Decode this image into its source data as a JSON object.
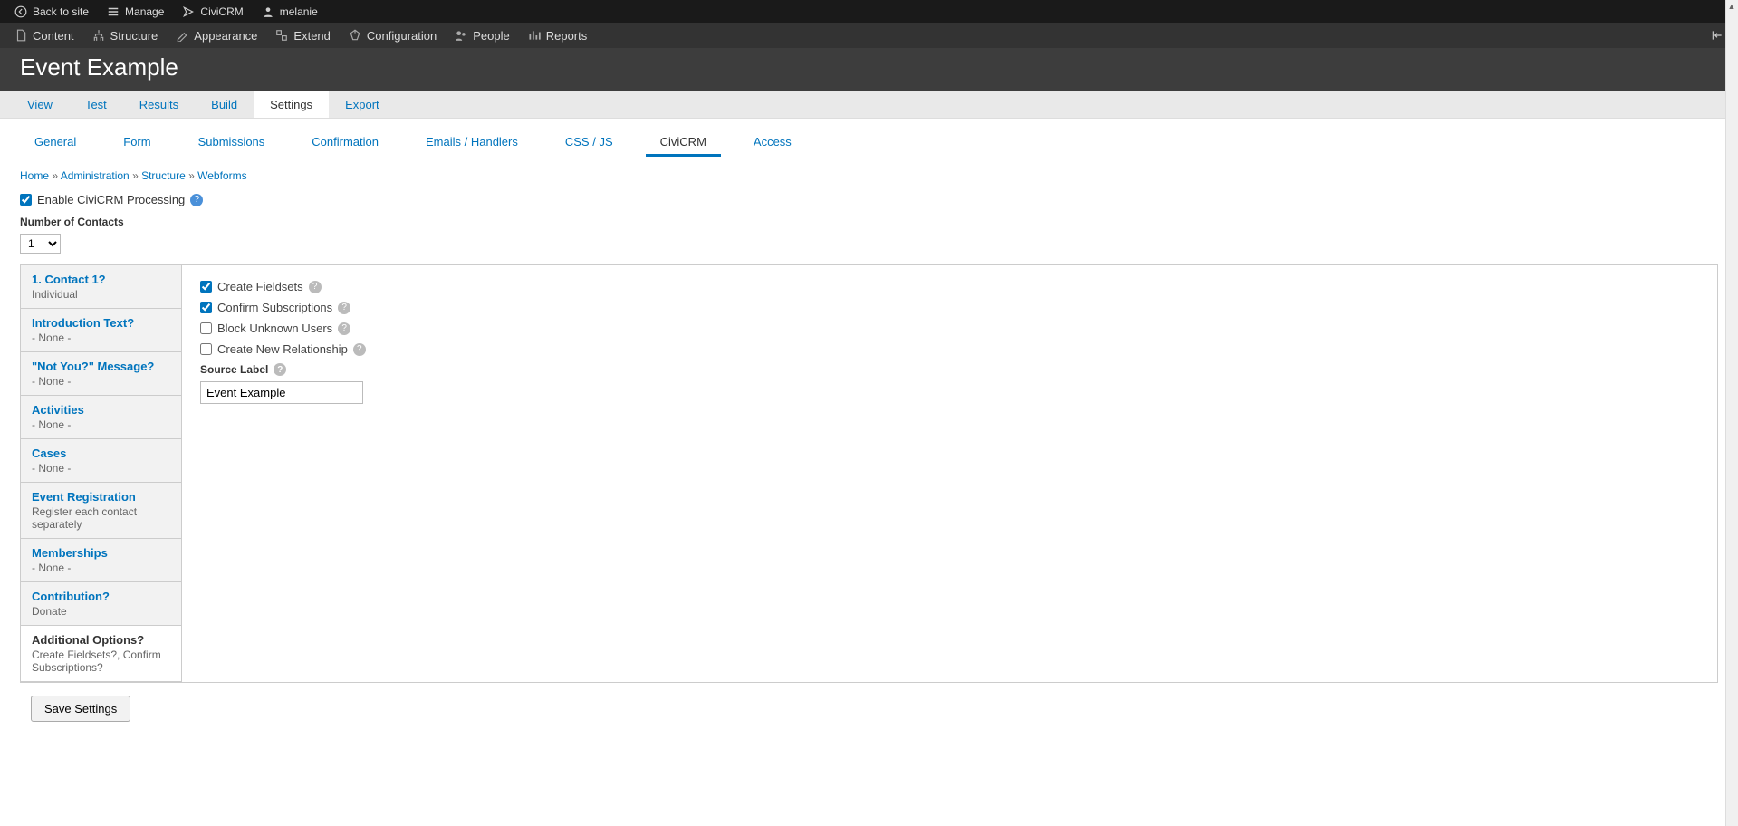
{
  "topbar": {
    "back": "Back to site",
    "manage": "Manage",
    "civicrm": "CiviCRM",
    "user": "melanie"
  },
  "adminbar": {
    "content": "Content",
    "structure": "Structure",
    "appearance": "Appearance",
    "extend": "Extend",
    "configuration": "Configuration",
    "people": "People",
    "reports": "Reports"
  },
  "page_title": "Event Example",
  "tabs": {
    "view": "View",
    "test": "Test",
    "results": "Results",
    "build": "Build",
    "settings": "Settings",
    "export": "Export"
  },
  "subtabs": {
    "general": "General",
    "form": "Form",
    "submissions": "Submissions",
    "confirmation": "Confirmation",
    "emails": "Emails / Handlers",
    "cssjs": "CSS / JS",
    "civicrm": "CiviCRM",
    "access": "Access"
  },
  "breadcrumb": {
    "home": "Home",
    "administration": "Administration",
    "structure": "Structure",
    "webforms": "Webforms"
  },
  "enable_label": "Enable CiviCRM Processing",
  "num_contacts_label": "Number of Contacts",
  "num_contacts_value": "1",
  "side": [
    {
      "t": "1. Contact 1?",
      "s": "Individual"
    },
    {
      "t": "Introduction Text?",
      "s": "- None -"
    },
    {
      "t": "\"Not You?\" Message?",
      "s": "- None -"
    },
    {
      "t": "Activities",
      "s": "- None -"
    },
    {
      "t": "Cases",
      "s": "- None -"
    },
    {
      "t": "Event Registration",
      "s": "Register each contact separately"
    },
    {
      "t": "Memberships",
      "s": "- None -"
    },
    {
      "t": "Contribution?",
      "s": "Donate"
    },
    {
      "t": "Additional Options?",
      "s": "Create Fieldsets?, Confirm Subscriptions?"
    }
  ],
  "options": {
    "create_fieldsets": "Create Fieldsets",
    "confirm_subs": "Confirm Subscriptions",
    "block_unknown": "Block Unknown Users",
    "create_rel": "Create New Relationship"
  },
  "source_label": "Source Label",
  "source_value": "Event Example",
  "save_button": "Save Settings"
}
